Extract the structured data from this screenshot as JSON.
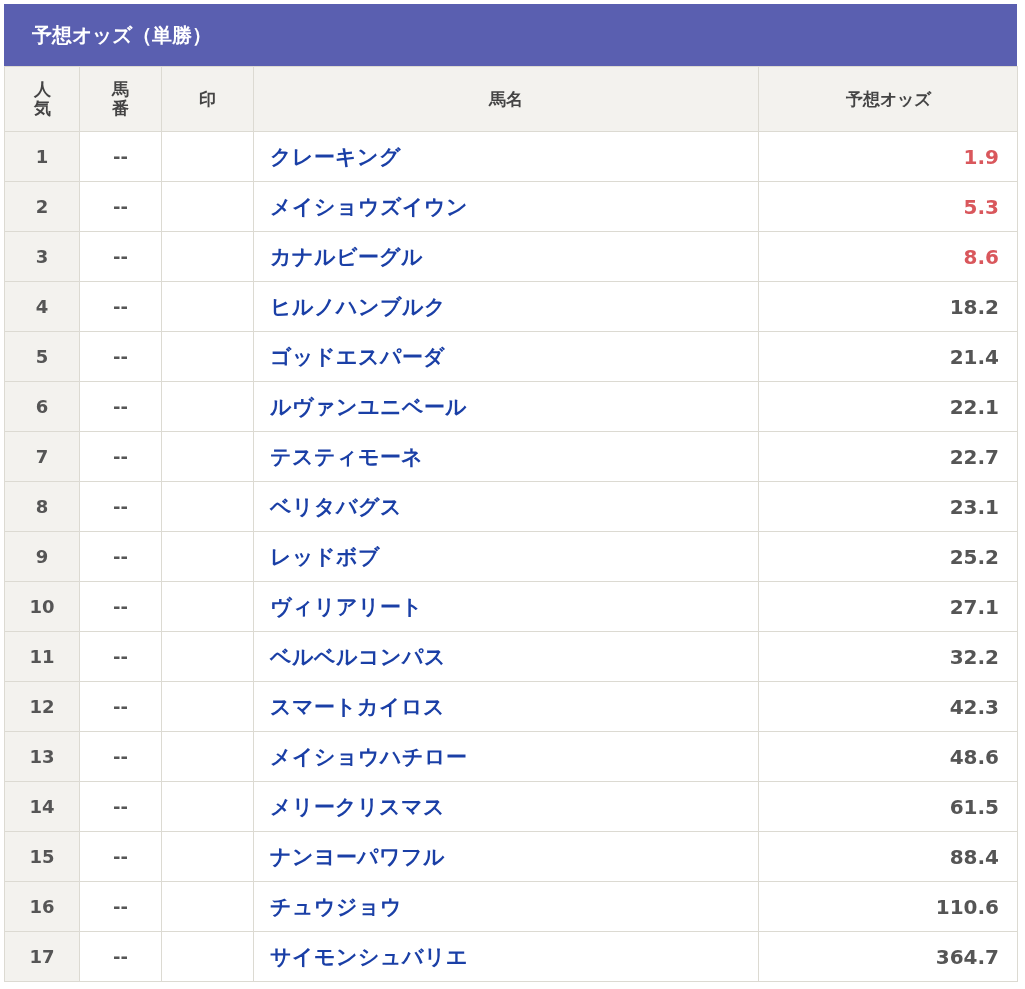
{
  "title": "予想オッズ（単勝）",
  "columns": [
    {
      "label": "人気",
      "vertical": true
    },
    {
      "label": "馬番",
      "vertical": true
    },
    {
      "label": "印",
      "vertical": false
    },
    {
      "label": "馬名",
      "vertical": false
    },
    {
      "label": "予想オッズ",
      "vertical": false
    }
  ],
  "rows": [
    {
      "rank": "1",
      "number": "--",
      "horse": "クレーキング",
      "odds": "1.9",
      "favorite": true
    },
    {
      "rank": "2",
      "number": "--",
      "horse": "メイショウズイウン",
      "odds": "5.3",
      "favorite": true
    },
    {
      "rank": "3",
      "number": "--",
      "horse": "カナルビーグル",
      "odds": "8.6",
      "favorite": true
    },
    {
      "rank": "4",
      "number": "--",
      "horse": "ヒルノハンブルク",
      "odds": "18.2",
      "favorite": false
    },
    {
      "rank": "5",
      "number": "--",
      "horse": "ゴッドエスパーダ",
      "odds": "21.4",
      "favorite": false
    },
    {
      "rank": "6",
      "number": "--",
      "horse": "ルヴァンユニベール",
      "odds": "22.1",
      "favorite": false
    },
    {
      "rank": "7",
      "number": "--",
      "horse": "テスティモーネ",
      "odds": "22.7",
      "favorite": false
    },
    {
      "rank": "8",
      "number": "--",
      "horse": "ベリタバグス",
      "odds": "23.1",
      "favorite": false
    },
    {
      "rank": "9",
      "number": "--",
      "horse": "レッドボブ",
      "odds": "25.2",
      "favorite": false
    },
    {
      "rank": "10",
      "number": "--",
      "horse": "ヴィリアリート",
      "odds": "27.1",
      "favorite": false
    },
    {
      "rank": "11",
      "number": "--",
      "horse": "ベルベルコンパス",
      "odds": "32.2",
      "favorite": false
    },
    {
      "rank": "12",
      "number": "--",
      "horse": "スマートカイロス",
      "odds": "42.3",
      "favorite": false
    },
    {
      "rank": "13",
      "number": "--",
      "horse": "メイショウハチロー",
      "odds": "48.6",
      "favorite": false
    },
    {
      "rank": "14",
      "number": "--",
      "horse": "メリークリスマス",
      "odds": "61.5",
      "favorite": false
    },
    {
      "rank": "15",
      "number": "--",
      "horse": "ナンヨーパワフル",
      "odds": "88.4",
      "favorite": false
    },
    {
      "rank": "16",
      "number": "--",
      "horse": "チュウジョウ",
      "odds": "110.6",
      "favorite": false
    },
    {
      "rank": "17",
      "number": "--",
      "horse": "サイモンシュバリエ",
      "odds": "364.7",
      "favorite": false
    }
  ]
}
